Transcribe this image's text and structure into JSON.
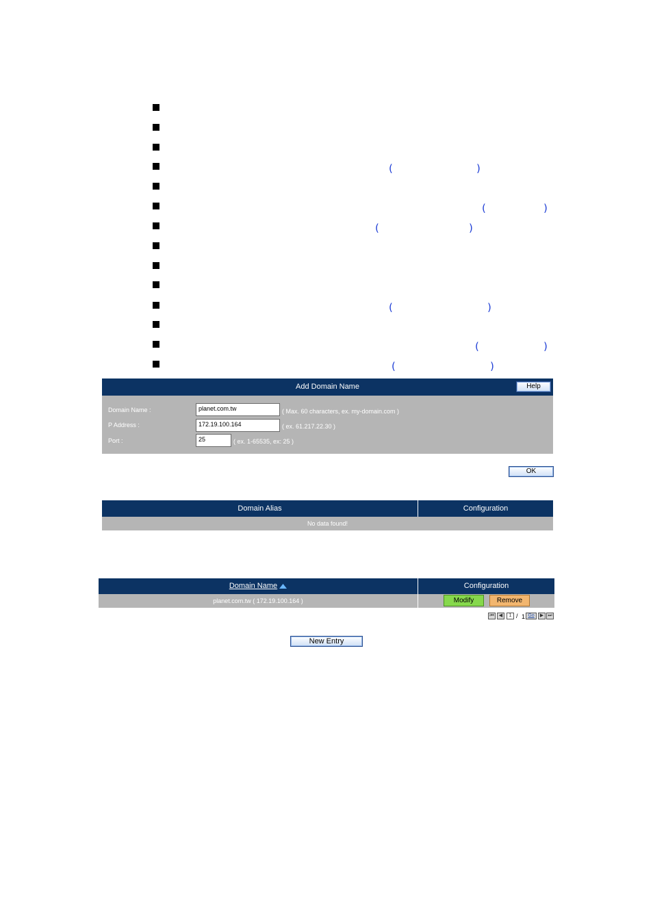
{
  "bullets_count": 14,
  "add_domain": {
    "title": "Add Domain Name",
    "help_label": "Help",
    "fields": [
      {
        "label": "Domain Name :",
        "value": "planet.com.tw",
        "hint": "( Max. 60 characters, ex. my-domain.com )"
      },
      {
        "label": "P Address :",
        "value": "172.19.100.164",
        "hint": "( ex. 61.217.22.30 )"
      },
      {
        "label": "Port :",
        "value": "25",
        "hint": "( ex. 1-65535, ex: 25 )"
      }
    ],
    "ok_label": "OK"
  },
  "alias_table": {
    "col_alias": "Domain Alias",
    "col_config": "Configuration",
    "empty_text": "No data found!"
  },
  "domain_table": {
    "col_name": "Domain Name",
    "col_config": "Configuration",
    "rows": [
      {
        "name": "planet.com.tw",
        "address": "( 172.19.100.164 )",
        "modify_label": "Modify",
        "remove_label": "Remove"
      }
    ],
    "pagination": {
      "current_page": "1",
      "separator": "/",
      "total_pages": "1",
      "go_label": "Go"
    }
  },
  "new_entry_label": "New Entry",
  "colors": {
    "header_bar": "#0c3363",
    "panel_gray": "#b5b5b5",
    "paren_blue": "#1f3fd6",
    "modify_green": "#86d84c",
    "remove_orange": "#f2b66f"
  }
}
